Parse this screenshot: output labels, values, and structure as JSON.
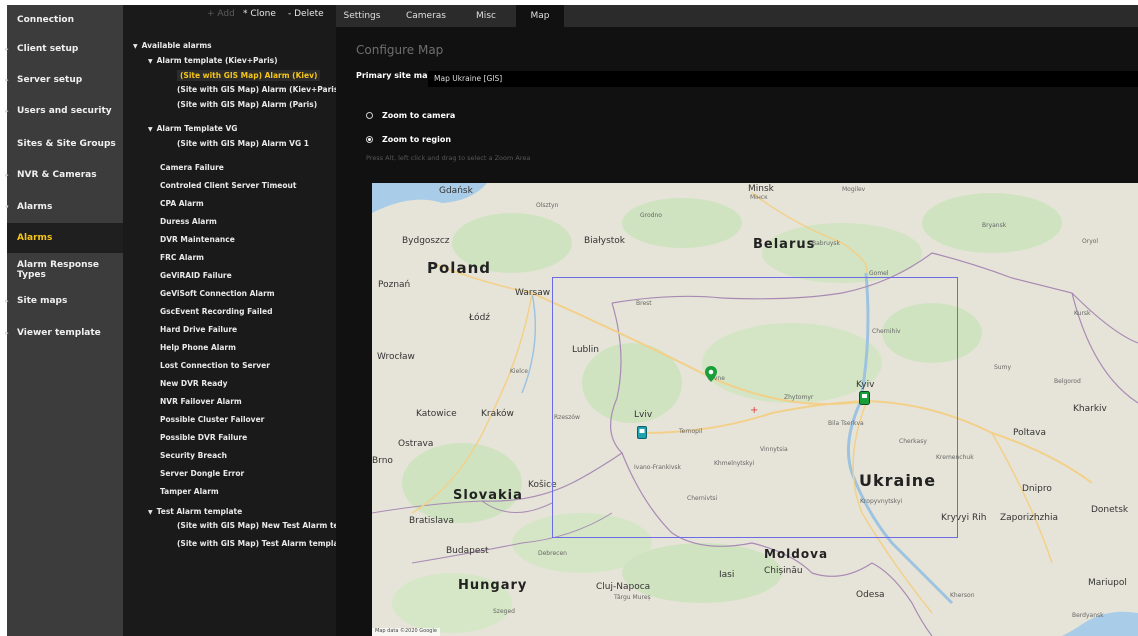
{
  "nav": {
    "items": [
      {
        "label": "Connection",
        "arrow": ""
      },
      {
        "label": "Client setup",
        "arrow": "▸"
      },
      {
        "label": "Server setup",
        "arrow": "▸"
      },
      {
        "label": "Users and security",
        "arrow": "▸"
      },
      {
        "label": "Sites & Site Groups",
        "arrow": ""
      },
      {
        "label": "NVR & Cameras",
        "arrow": "▸"
      },
      {
        "label": "Alarms",
        "arrow": "▾"
      },
      {
        "label": "Alarms",
        "arrow": ""
      },
      {
        "label": "Alarm Response Types",
        "arrow": ""
      },
      {
        "label": "Site maps",
        "arrow": "▸"
      },
      {
        "label": "Viewer template",
        "arrow": "▸"
      }
    ],
    "active_index": 7
  },
  "toolbar": {
    "add": "+ Add",
    "clone": "* Clone",
    "delete": "- Delete"
  },
  "tree": {
    "lines": [
      {
        "text": "Available alarms",
        "twisty": "▼",
        "indent": 0
      },
      {
        "text": "Alarm template (Kiev+Paris)",
        "twisty": "▼",
        "indent": 1
      },
      {
        "text": "(Site with GIS Map) Alarm (Kiev)",
        "twisty": "",
        "indent": 2,
        "selected": true
      },
      {
        "text": "(Site with GIS Map) Alarm (Kiev+Paris)",
        "twisty": "",
        "indent": 2
      },
      {
        "text": "(Site with GIS Map) Alarm (Paris)",
        "twisty": "",
        "indent": 2
      },
      {
        "text": "Alarm Template VG",
        "twisty": "▼",
        "indent": 1
      },
      {
        "text": "(Site with GIS Map) Alarm VG 1",
        "twisty": "",
        "indent": 2
      },
      {
        "text": "Camera Failure",
        "twisty": "",
        "indent": 1
      },
      {
        "text": "Controled Client Server Timeout",
        "twisty": "",
        "indent": 1
      },
      {
        "text": "CPA Alarm",
        "twisty": "",
        "indent": 1
      },
      {
        "text": "Duress Alarm",
        "twisty": "",
        "indent": 1
      },
      {
        "text": "DVR Maintenance",
        "twisty": "",
        "indent": 1
      },
      {
        "text": "FRC Alarm",
        "twisty": "",
        "indent": 1
      },
      {
        "text": "GeViRAID Failure",
        "twisty": "",
        "indent": 1
      },
      {
        "text": "GeViSoft Connection Alarm",
        "twisty": "",
        "indent": 1
      },
      {
        "text": "GscEvent Recording Failed",
        "twisty": "",
        "indent": 1
      },
      {
        "text": "Hard Drive Failure",
        "twisty": "",
        "indent": 1
      },
      {
        "text": "Help Phone Alarm",
        "twisty": "",
        "indent": 1
      },
      {
        "text": "Lost Connection to Server",
        "twisty": "",
        "indent": 1
      },
      {
        "text": "New DVR Ready",
        "twisty": "",
        "indent": 1
      },
      {
        "text": "NVR Failover Alarm",
        "twisty": "",
        "indent": 1
      },
      {
        "text": "Possible Cluster Failover",
        "twisty": "",
        "indent": 1
      },
      {
        "text": "Possible DVR Failure",
        "twisty": "",
        "indent": 1
      },
      {
        "text": "Security Breach",
        "twisty": "",
        "indent": 1
      },
      {
        "text": "Server Dongle Error",
        "twisty": "",
        "indent": 1
      },
      {
        "text": "Tamper Alarm",
        "twisty": "",
        "indent": 1
      },
      {
        "text": "Test Alarm template",
        "twisty": "▼",
        "indent": 1
      },
      {
        "text": "(Site with GIS Map) New Test Alarm te",
        "twisty": "",
        "indent": 2
      },
      {
        "text": "(Site with GIS Map) Test Alarm templat",
        "twisty": "",
        "indent": 2
      }
    ]
  },
  "tabs": [
    {
      "label": "Settings"
    },
    {
      "label": "Cameras"
    },
    {
      "label": "Misc"
    },
    {
      "label": "Map"
    }
  ],
  "active_tab": "Map",
  "config": {
    "title": "Configure Map",
    "primary_label": "Primary site map",
    "primary_value": "Map Ukraine [GIS]",
    "zoom_camera": "Zoom to camera",
    "zoom_region": "Zoom to region",
    "zoom_region_selected": true,
    "hint": "Press Alt, left click and drag to select a Zoom Area"
  },
  "map": {
    "labels": {
      "poland": "Poland",
      "belarus": "Belarus",
      "ukraine": "Ukraine",
      "slovakia": "Slovakia",
      "hungary": "Hungary",
      "moldova": "Moldova",
      "gdansk": "Gdańsk",
      "olsztyn": "Olsztyn",
      "minsk": "Minsk",
      "minsk_local": "Мінск",
      "mogilev": "Mogilev",
      "bydgoszcz": "Bydgoszcz",
      "bialystok": "Białystok",
      "grodno": "Grodno",
      "babruysk": "Babruysk",
      "bryansk": "Bryansk",
      "poznan": "Poznań",
      "warsaw": "Warsaw",
      "lodz": "Łódź",
      "brest": "Brest",
      "gomel": "Gomel",
      "kursk": "Kursk",
      "wroclaw": "Wrocław",
      "lublin": "Lublin",
      "kielce": "Kielce",
      "chernihiv": "Chernihiv",
      "rivne": "Rivne",
      "zhytomyr": "Zhytomyr",
      "kyiv": "Kyiv",
      "sumy": "Sumy",
      "belgorod": "Belgorod",
      "katowice": "Katowice",
      "krakow": "Kraków",
      "rzeszow": "Rzeszów",
      "lviv": "Lviv",
      "ternopil": "Ternopil",
      "bila_tserkva": "Bila Tserkva",
      "kharkiv": "Kharkiv",
      "ostrava": "Ostrava",
      "poltava": "Poltava",
      "cherkasy": "Cherkasy",
      "vinnytsia": "Vinnytsia",
      "khmelnytskyi": "Khmelnytskyi",
      "ivano_frankivsk": "Ivano-Frankivsk",
      "brno": "Brno",
      "kosice": "Košice",
      "kremenchuk": "Kremenchuk",
      "chernivtsi": "Chernivtsi",
      "kropyvnytskyi": "Kropyvnytskyi",
      "dnipro": "Dnipro",
      "donetsk": "Donetsk",
      "bratislava": "Bratislava",
      "kryvyi_rih": "Kryvyi Rih",
      "zaporizhzhia": "Zaporizhzhia",
      "budapest": "Budapest",
      "debrecen": "Debrecen",
      "iasi": "Iasi",
      "chisinau": "Chișinău",
      "mariupol": "Mariupol",
      "cluj": "Cluj-Napoca",
      "targu_mures": "Târgu Mureș",
      "szeged": "Szeged",
      "odesa": "Odesa",
      "kherson": "Kherson",
      "berdyansk": "Berdyansk",
      "oryol": "Oryol"
    },
    "attribution": "Map data ©2020 Google"
  },
  "colors": {
    "accent": "#f5c518",
    "selection_rect": "#6b6be6",
    "pin_green": "#1a9e3a",
    "pin_teal": "#1fa3b0"
  }
}
